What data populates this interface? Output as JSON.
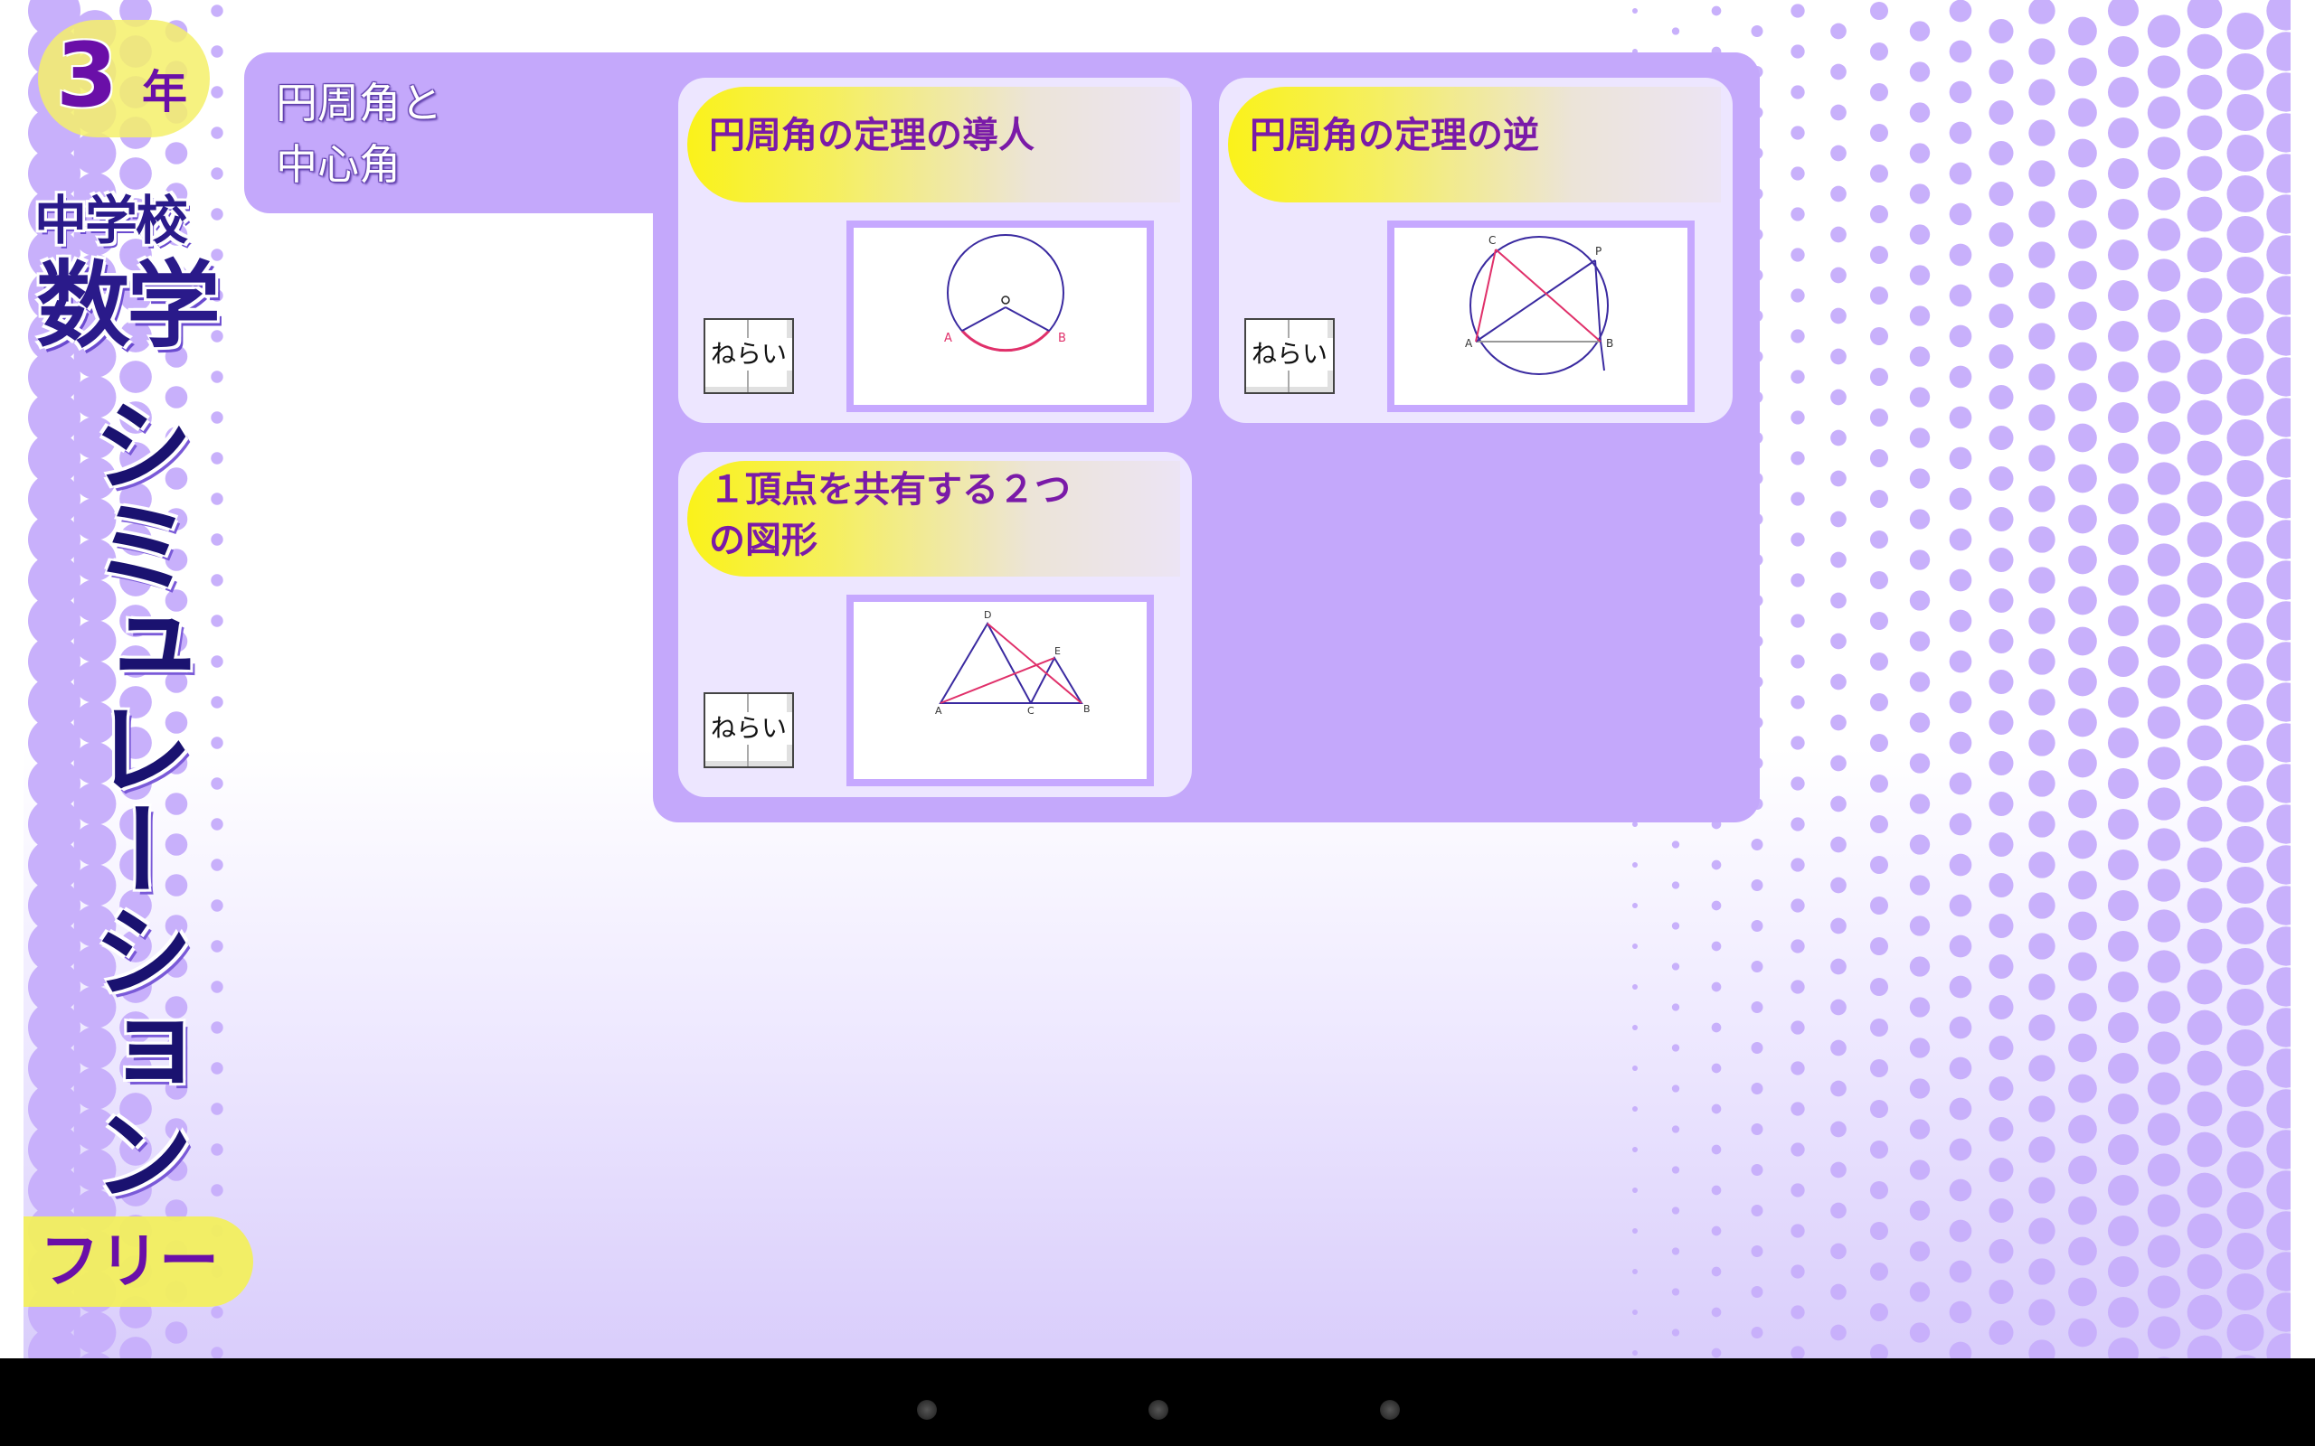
{
  "sidebar": {
    "grade_number": "3",
    "grade_unit": "年",
    "school": "中学校",
    "subject": "数学",
    "app_name": "シミュレーション",
    "edition": "フリー"
  },
  "unit": {
    "title_line1": "円周角と",
    "title_line2": "中心角"
  },
  "cards": [
    {
      "title": "円周角の定理の導人",
      "aim_label": "ねらい",
      "figure_labels": [
        "A",
        "O",
        "B"
      ]
    },
    {
      "title": "円周角の定理の逆",
      "aim_label": "ねらい",
      "figure_labels": [
        "C",
        "P",
        "A",
        "B"
      ]
    },
    {
      "title_line1": "１頂点を共有する２つ",
      "title_line2": "の図形",
      "aim_label": "ねらい",
      "figure_labels": [
        "D",
        "E",
        "A",
        "C",
        "B"
      ]
    }
  ],
  "colors": {
    "panel": "#c4a8fb",
    "card": "#ede6ff",
    "title_text": "#7a1aa8",
    "highlight": "#faf21a"
  },
  "icons": [
    "book-icon",
    "nav-back-icon",
    "nav-home-icon",
    "nav-recents-icon"
  ]
}
